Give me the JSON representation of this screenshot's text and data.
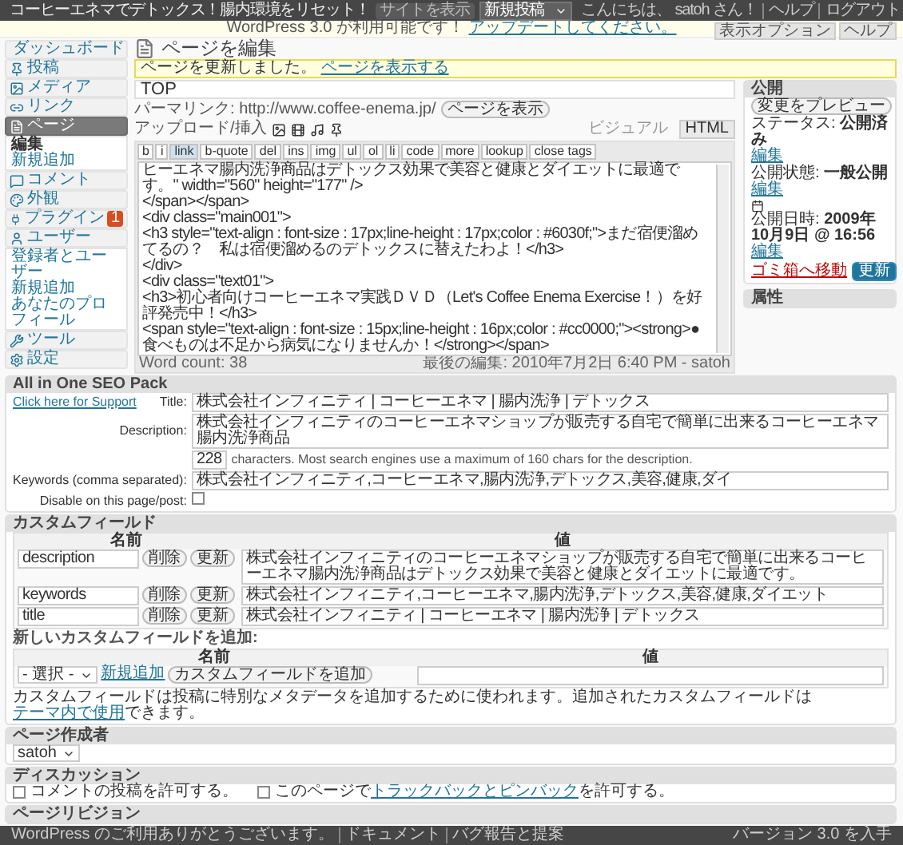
{
  "admin_bar": {
    "site_title": "コーヒーエネマでデトックス！腸内環境をリセット！",
    "view_site": "サイトを表示",
    "new_menu": "新規投稿",
    "user_links": [
      "こんにちは、 satoh さん！",
      "ヘルプ",
      "ログアウト"
    ]
  },
  "update_notice": {
    "text": "WordPress 3.0 が利用可能です！",
    "link": "アップデートしてください。"
  },
  "screen_buttons": [
    "表示オプション",
    "ヘルプ"
  ],
  "sidebar": {
    "items": [
      {
        "label": "ダッシュボード",
        "selected": false
      },
      {
        "label": "投稿",
        "selected": false
      },
      {
        "label": "メディア",
        "selected": false
      },
      {
        "label": "リンク",
        "selected": false
      },
      {
        "label": "ページ",
        "selected": true,
        "children": [
          {
            "label": "編集",
            "selected": true
          },
          {
            "label": "新規追加",
            "selected": false
          }
        ]
      },
      {
        "label": "コメント",
        "selected": false
      },
      {
        "label": "外観",
        "selected": false
      },
      {
        "label": "プラグイン",
        "selected": false,
        "badge": "1"
      },
      {
        "label": "ユーザー",
        "selected": false,
        "children": [
          {
            "label": "登録者とユーザー",
            "selected": false
          },
          {
            "label": "新規追加",
            "selected": false
          },
          {
            "label": "あなたのプロフィール",
            "selected": false
          }
        ]
      },
      {
        "label": "ツール",
        "selected": false
      },
      {
        "label": "設定",
        "selected": false
      }
    ]
  },
  "page": {
    "heading": "ページを編集",
    "message": {
      "text": "ページを更新しました。",
      "link": "ページを表示する"
    }
  },
  "editor": {
    "title": "TOP",
    "permalink_label": "パーマリンク:",
    "permalink": "http://www.coffee-enema.jp/",
    "view_button": "ページを表示",
    "upload_label": "アップロード/挿入",
    "tabs": [
      {
        "label": "ビジュアル",
        "selected": false
      },
      {
        "label": "HTML",
        "selected": true
      }
    ],
    "quicktags": [
      {
        "label": "b",
        "selected": false
      },
      {
        "label": "i",
        "selected": false
      },
      {
        "label": "link",
        "selected": true
      },
      {
        "label": "b-quote",
        "selected": false
      },
      {
        "label": "del",
        "selected": false
      },
      {
        "label": "ins",
        "selected": false
      },
      {
        "label": "img",
        "selected": false
      },
      {
        "label": "ul",
        "selected": false
      },
      {
        "label": "ol",
        "selected": false
      },
      {
        "label": "li",
        "selected": false
      },
      {
        "label": "code",
        "selected": false
      },
      {
        "label": "more",
        "selected": false
      },
      {
        "label": "lookup",
        "selected": false
      },
      {
        "label": "close tags",
        "selected": false
      }
    ],
    "content_lines": [
      "ヒーエネマ腸内洗浄商品はデトックス効果で美容と健康とダイエットに最適です。\" width=\"560\" height=\"177\" />",
      "</span></span>",
      "<div class=\"main001\">",
      "<h3 style=\"text-align : font-size : 17px;line-height : 17px;color : #6030f;\">まだ宿便溜めてるの？　私は宿便溜めるのデトックスに替えたわよ！</h3>",
      "</div>",
      "<div class=\"text01\">",
      "<h3>初心者向けコーヒーエネマ実践ＤＶＤ（Let's Coffee Enema Exercise！）を好評発売中！</h3>",
      "<span style=\"text-align : font-size : 15px;line-height : 16px;color : #cc0000;\"><strong>●食べものは不足から病気になりませんか！</strong></span>"
    ],
    "word_count": "Word count: 38",
    "last_edit": "最後の編集: 2010年7月2日 6:40 PM - satoh"
  },
  "publish": {
    "title": "公開",
    "preview": "変更をプレビュー",
    "status": {
      "label": "ステータス:",
      "value": "公開済み",
      "link": "編集"
    },
    "visibility": {
      "label": "公開状態:",
      "value": "一般公開",
      "link": "編集"
    },
    "date": {
      "label": "公開日時:",
      "value": "2009年10月9日 @ 16:56",
      "link": "編集"
    },
    "trash": "ゴミ箱へ移動",
    "update": "更新"
  },
  "attributes": {
    "title": "属性"
  },
  "seo": {
    "title": "All in One SEO Pack",
    "support_link": "Click here for Support",
    "title_label": "Title:",
    "title_value": "株式会社インフィニティ | コーヒーエネマ | 腸内洗浄 | デトックス",
    "description_label": "Description:",
    "description_value": "株式会社インフィニティのコーヒーエネマショップが販売する自宅で簡単に出来るコーヒーエネマ腸内洗浄商品",
    "char_count": "228",
    "char_note": "characters. Most search engines use a maximum of 160 chars for the description.",
    "keywords_label": "Keywords (comma separated):",
    "keywords_value": "株式会社インフィニティ,コーヒーエネマ,腸内洗浄,デトックス,美容,健康,ダイ",
    "disable_label": "Disable on this page/post:",
    "disable_checked": false
  },
  "custom_fields": {
    "title": "カスタムフィールド",
    "columns": [
      "名前",
      "値"
    ],
    "rows": [
      {
        "name": "description",
        "value": "株式会社インフィニティのコーヒーエネマショップが販売する自宅で簡単に出来るコーヒーエネマ腸内洗浄商品はデトックス効果で美容と健康とダイエットに最適です。",
        "buttons": [
          "削除",
          "更新"
        ]
      },
      {
        "name": "keywords",
        "value": "株式会社インフィニティ,コーヒーエネマ,腸内洗浄,デトックス,美容,健康,ダイエット",
        "buttons": [
          "削除",
          "更新"
        ]
      },
      {
        "name": "title",
        "value": "株式会社インフィニティ | コーヒーエネマ | 腸内洗浄 | デトックス",
        "buttons": [
          "削除",
          "更新"
        ]
      }
    ],
    "add_title": "新しいカスタムフィールドを追加:",
    "add_columns": [
      "名前",
      "値"
    ],
    "select_placeholder": "- 選択 -",
    "new_link": "新規追加",
    "add_button": "カスタムフィールドを追加",
    "note": "カスタムフィールドは投稿に特別なメタデータを追加するために使われます。追加されたカスタムフィールドは",
    "note_link": "テーマ内で使用",
    "note_end": "できます。"
  },
  "author": {
    "title": "ページ作成者",
    "value": "satoh"
  },
  "discussion": {
    "title": "ディスカッション",
    "options": [
      {
        "text": "コメントの投稿を許可する。",
        "checked": false
      },
      {
        "text": "このページで",
        "link": "トラックバックとピンバック",
        "after": "を許可する。",
        "checked": false
      }
    ]
  },
  "revisions": {
    "title": "ページリビジョン"
  },
  "footer": {
    "left": [
      "WordPress のご利用ありがとうございます。",
      "ドキュメント",
      "バグ報告と提案"
    ],
    "right": "バージョン 3.0 を入手"
  }
}
